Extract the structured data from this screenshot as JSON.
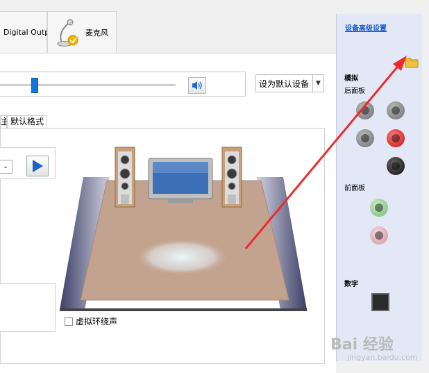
{
  "devices": {
    "digital_output": "Digital Output",
    "microphone": "麦克风"
  },
  "volume": {
    "level_fraction": 0.2,
    "set_default_label": "设为默认设备"
  },
  "subtabs": {
    "truncated": "主",
    "default_format": "默认格式"
  },
  "scene": {
    "virtual_surround_label": "虚拟环绕声",
    "virtual_surround_checked": false
  },
  "right_panel": {
    "advanced_link": "设备高级设置",
    "analog_title": "模拟",
    "rear_panel": "后面板",
    "front_panel": "前面板",
    "digital_title": "数字",
    "rear_jacks": [
      "grey",
      "grey",
      "grey",
      "red",
      "black"
    ],
    "front_jacks": [
      "green",
      "pink"
    ]
  },
  "watermark": {
    "brand": "Bai 经验",
    "url": "jingyan.baidu.com"
  },
  "colors": {
    "accent_blue": "#1277d8",
    "annotation_red": "#ee2a2a",
    "right_panel_bg": "#e3e8f6"
  }
}
